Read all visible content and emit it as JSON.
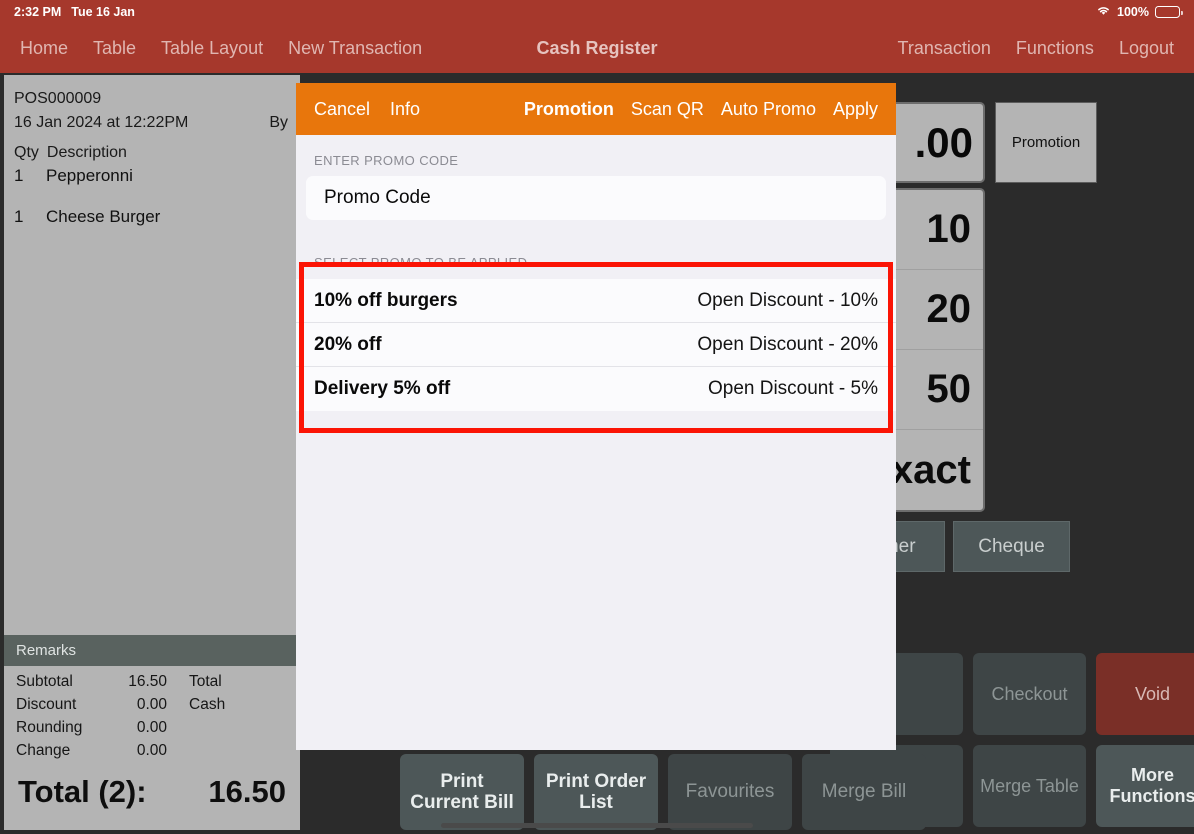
{
  "status_bar": {
    "time": "2:32 PM",
    "date": "Tue 16 Jan",
    "battery_percent": "100%",
    "wifi_icon": "wifi-icon",
    "battery_icon": "battery-icon"
  },
  "nav": {
    "title": "Cash Register",
    "left_items": [
      "Home",
      "Table",
      "Table Layout",
      "New Transaction"
    ],
    "right_items": [
      "Transaction",
      "Functions",
      "Logout"
    ]
  },
  "receipt": {
    "order_id": "POS000009",
    "datetime": "16 Jan 2024 at 12:22PM",
    "by_label": "By",
    "col_qty": "Qty",
    "col_description": "Description",
    "items": [
      {
        "qty": "1",
        "description": "Pepperonni"
      },
      {
        "qty": "1",
        "description": "Cheese Burger"
      }
    ],
    "remarks_label": "Remarks",
    "totals_left": [
      {
        "label": "Subtotal",
        "value": "16.50"
      },
      {
        "label": "Discount",
        "value": "0.00"
      },
      {
        "label": "Rounding",
        "value": "0.00"
      },
      {
        "label": "Change",
        "value": "0.00"
      }
    ],
    "totals_right": [
      {
        "label": "Total"
      },
      {
        "label": "Cash"
      }
    ],
    "grand_label": "Total (2):",
    "grand_value": "16.50"
  },
  "right_panel": {
    "amount_display": ".00",
    "promotion_button": "Promotion",
    "quick_cash": [
      "10",
      "20",
      "50",
      "Exact"
    ],
    "pay_types": [
      "oucher",
      "Cheque"
    ],
    "functions": [
      {
        "label": "Checkout",
        "style": "dim"
      },
      {
        "label": "Void",
        "style": "danger"
      },
      {
        "label": "Merge Table",
        "style": "dim"
      },
      {
        "label": "More Functions",
        "style": "light"
      }
    ],
    "bottom_buttons": [
      {
        "label": "Print Current Bill",
        "style": "light"
      },
      {
        "label": "Print Order List",
        "style": "light"
      },
      {
        "label": "Favourites",
        "style": "dim"
      },
      {
        "label": "Merge Bill",
        "style": "dim"
      }
    ]
  },
  "modal": {
    "header": {
      "cancel": "Cancel",
      "info": "Info",
      "title": "Promotion",
      "scan_qr": "Scan QR",
      "auto_promo": "Auto Promo",
      "apply": "Apply"
    },
    "promo_code_section_label": "ENTER PROMO CODE",
    "promo_code_placeholder": "Promo Code",
    "promo_code_value": "",
    "select_promo_section_label": "SELECT PROMO TO BE APPLIED",
    "promos": [
      {
        "name": "10% off burgers",
        "value": "Open Discount - 10%"
      },
      {
        "name": "20% off",
        "value": "Open Discount - 20%"
      },
      {
        "name": "Delivery 5% off",
        "value": "Open Discount - 5%"
      }
    ]
  },
  "colors": {
    "nav_bar": "#a6382c",
    "modal_header": "#e8760c",
    "highlight": "#fb1405",
    "void_button": "#7a2f27",
    "receipt_bg": "#b4b4b4"
  }
}
